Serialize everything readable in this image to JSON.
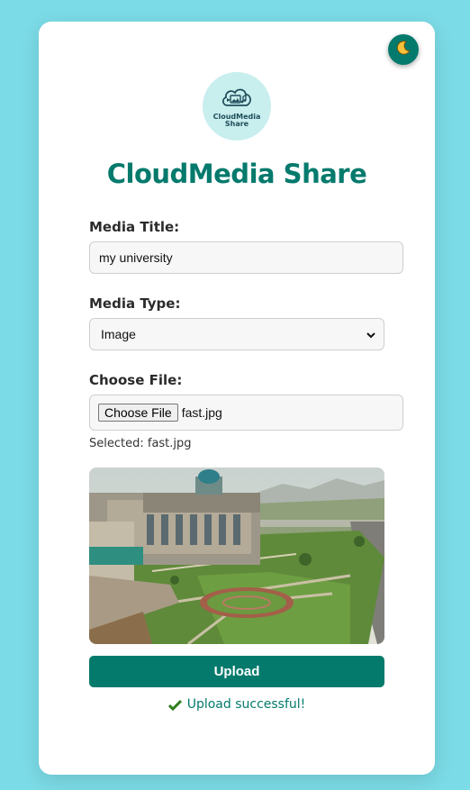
{
  "app": {
    "title": "CloudMedia Share",
    "logo_text": "CloudMedia\nShare",
    "theme_toggle_icon": "moon-icon"
  },
  "form": {
    "title_label": "Media Title:",
    "title_value": "my university",
    "type_label": "Media Type:",
    "type_selected": "Image",
    "file_label": "Choose File:",
    "file_button": "Choose File",
    "file_name": "fast.jpg",
    "selected_text": "Selected: fast.jpg",
    "upload_label": "Upload"
  },
  "status": {
    "message": "Upload successful!",
    "icon": "check-icon"
  },
  "colors": {
    "accent": "#047a6d",
    "background": "#7bdbe6",
    "card": "#ffffff",
    "logo_bg": "#c8eeee"
  }
}
